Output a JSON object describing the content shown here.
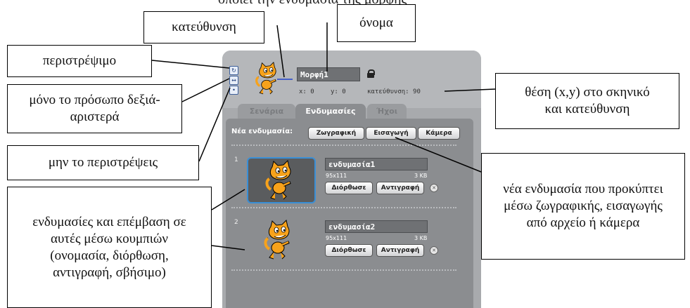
{
  "top_cut_text": [
    "οποιεί την ενδυμασία της μορφής"
  ],
  "sprite": {
    "name": "Μορφή1",
    "x_label": "x: 0",
    "y_label": "y: 0",
    "direction_label": "κατεύθυνση: 90",
    "rotation_styles": [
      "rotate-icon",
      "left-right-icon",
      "dont-rotate-icon"
    ]
  },
  "tabs": [
    {
      "label": "Σενάρια",
      "active": false
    },
    {
      "label": "Ενδυμασίες",
      "active": true
    },
    {
      "label": "Ήχοι",
      "active": false
    }
  ],
  "new_costume": {
    "label": "Νέα ενδυμασία:",
    "buttons": [
      "Ζωγραφική",
      "Εισαγωγή",
      "Κάμερα"
    ]
  },
  "costumes": [
    {
      "number": "1",
      "name": "ενδυμασία1",
      "dimensions": "95x111",
      "size": "3 KB",
      "selected": true
    },
    {
      "number": "2",
      "name": "ενδυμασία2",
      "dimensions": "95x111",
      "size": "3 KB",
      "selected": false
    }
  ],
  "costume_buttons": {
    "edit": "Διόρθωσε",
    "copy": "Αντιγραφή"
  },
  "callouts": {
    "direction": "κατεύθυνση",
    "name": "όνομα",
    "rotate": "περιστρέψιμο",
    "left_right": "μόνο το πρόσωπο δεξιά-αριστερά",
    "no_rotate": "μην το περιστρέψεις",
    "position": "θέση (x,y) στο σκηνικό και κατεύθυνση",
    "new_costume": "νέα ενδυμασία που προκύπτει μέσω ζωγραφικής, εισαγωγής από αρχείο ή κάμερα",
    "costumes": "ενδυμασίες και επέμβαση σε αυτές μέσω κουμπιών (ονομασία, διόρθωση, αντιγραφή, σβήσιμο)"
  },
  "colors": {
    "panel": "#a8aaad",
    "costume_area": "#8b8d90",
    "selected_border": "#3a8fd6",
    "cat_orange": "#f7a21b"
  }
}
